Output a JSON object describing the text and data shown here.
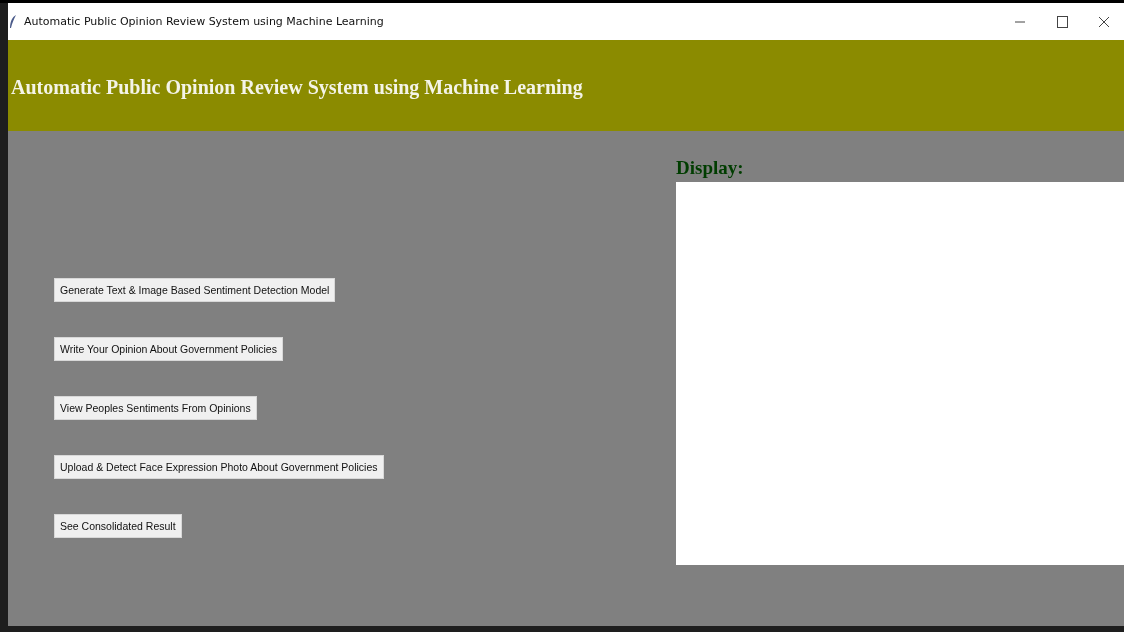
{
  "window": {
    "title": "Automatic Public Opinion Review System using Machine Learning"
  },
  "header": {
    "title": "Automatic Public Opinion Review System using Machine Learning"
  },
  "buttons": [
    {
      "label": "Generate Text & Image Based Sentiment Detection Model"
    },
    {
      "label": "Write Your Opinion About Government Policies"
    },
    {
      "label": "View Peoples Sentiments From Opinions"
    },
    {
      "label": "Upload & Detect Face Expression Photo About Government Policies"
    },
    {
      "label": "See Consolidated Result"
    }
  ],
  "display": {
    "label": "Display:"
  }
}
